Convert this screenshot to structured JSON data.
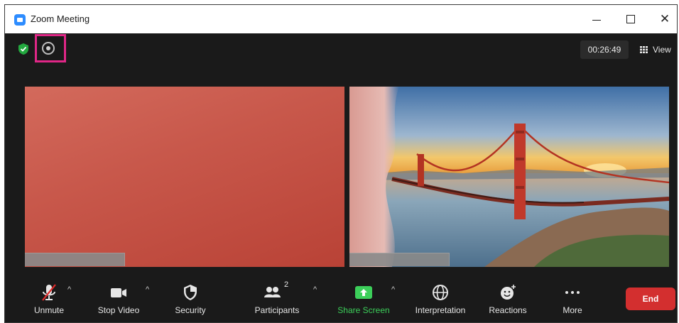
{
  "window": {
    "title": "Zoom Meeting",
    "controls": {
      "minimize": "–",
      "maximize": "□",
      "close": "✕"
    }
  },
  "topbar": {
    "security_status_icon": "green-shield-check-icon",
    "recording_icon": "record-circle-icon",
    "timer": "00:26:49",
    "view_label": "View"
  },
  "tiles": [
    {
      "name": "left-participant",
      "background": "coral-red"
    },
    {
      "name": "right-participant",
      "background": "golden-gate-bridge"
    }
  ],
  "toolbar": {
    "unmute": "Unmute",
    "stop_video": "Stop Video",
    "security": "Security",
    "participants": "Participants",
    "participants_count": "2",
    "share_screen": "Share Screen",
    "interpretation": "Interpretation",
    "reactions": "Reactions",
    "more": "More",
    "end": "End"
  },
  "colors": {
    "accent_green": "#3ccf5a",
    "end_red": "#d32f2f",
    "highlight_pink": "#e02787",
    "zoom_blue": "#2d8cff"
  }
}
